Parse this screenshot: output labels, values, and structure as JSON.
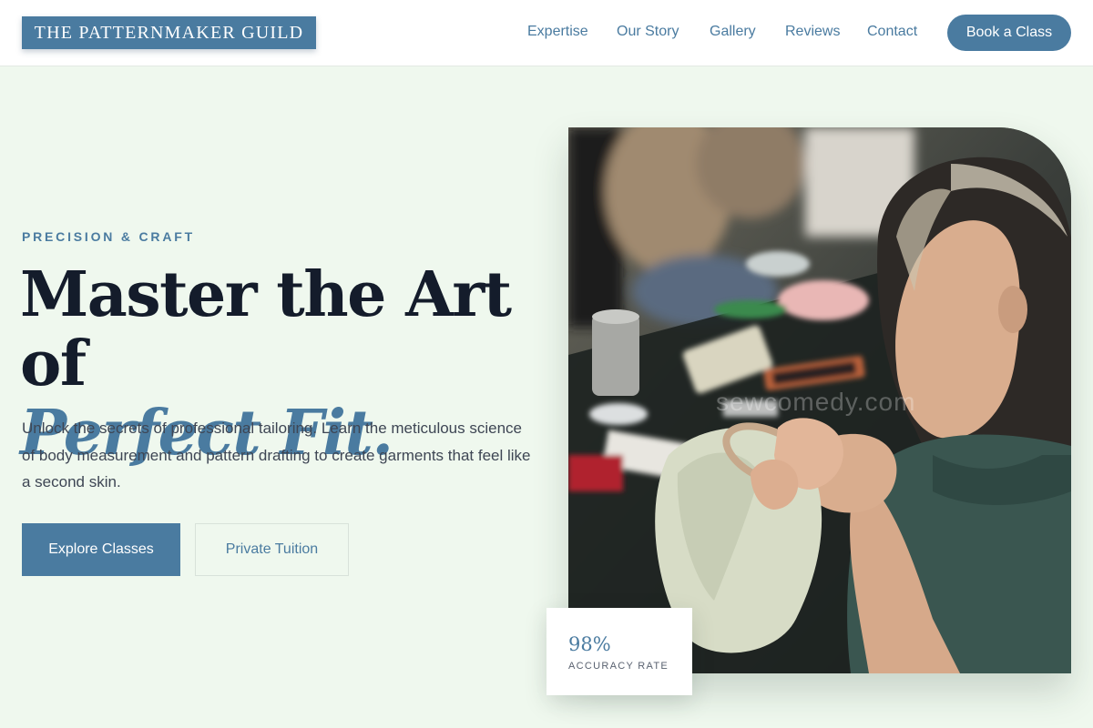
{
  "header": {
    "logo": "THE PATTERNMAKER GUILD",
    "nav": [
      "Expertise",
      "Our Story",
      "Gallery",
      "Reviews",
      "Contact"
    ],
    "cta": "Book a Class"
  },
  "hero": {
    "eyebrow": "PRECISION & CRAFT",
    "headline_line1": "Master the Art of",
    "headline_line2": "Perfect Fit.",
    "description": "Unlock the secrets of professional tailoring. Learn the meticulous science of body measurement and pattern drafting to create garments that feel like a second skin.",
    "primary_button": "Explore Classes",
    "secondary_button": "Private Tuition"
  },
  "image": {
    "alt": "Woman hand-sewing fabric in an embroidery hoop",
    "watermark": "sewcomedy.com"
  },
  "stat": {
    "value": "98%",
    "label": "ACCURACY RATE"
  },
  "colors": {
    "accent": "#4a7ba0",
    "background": "#eff8ee",
    "heading": "#141c2b"
  }
}
